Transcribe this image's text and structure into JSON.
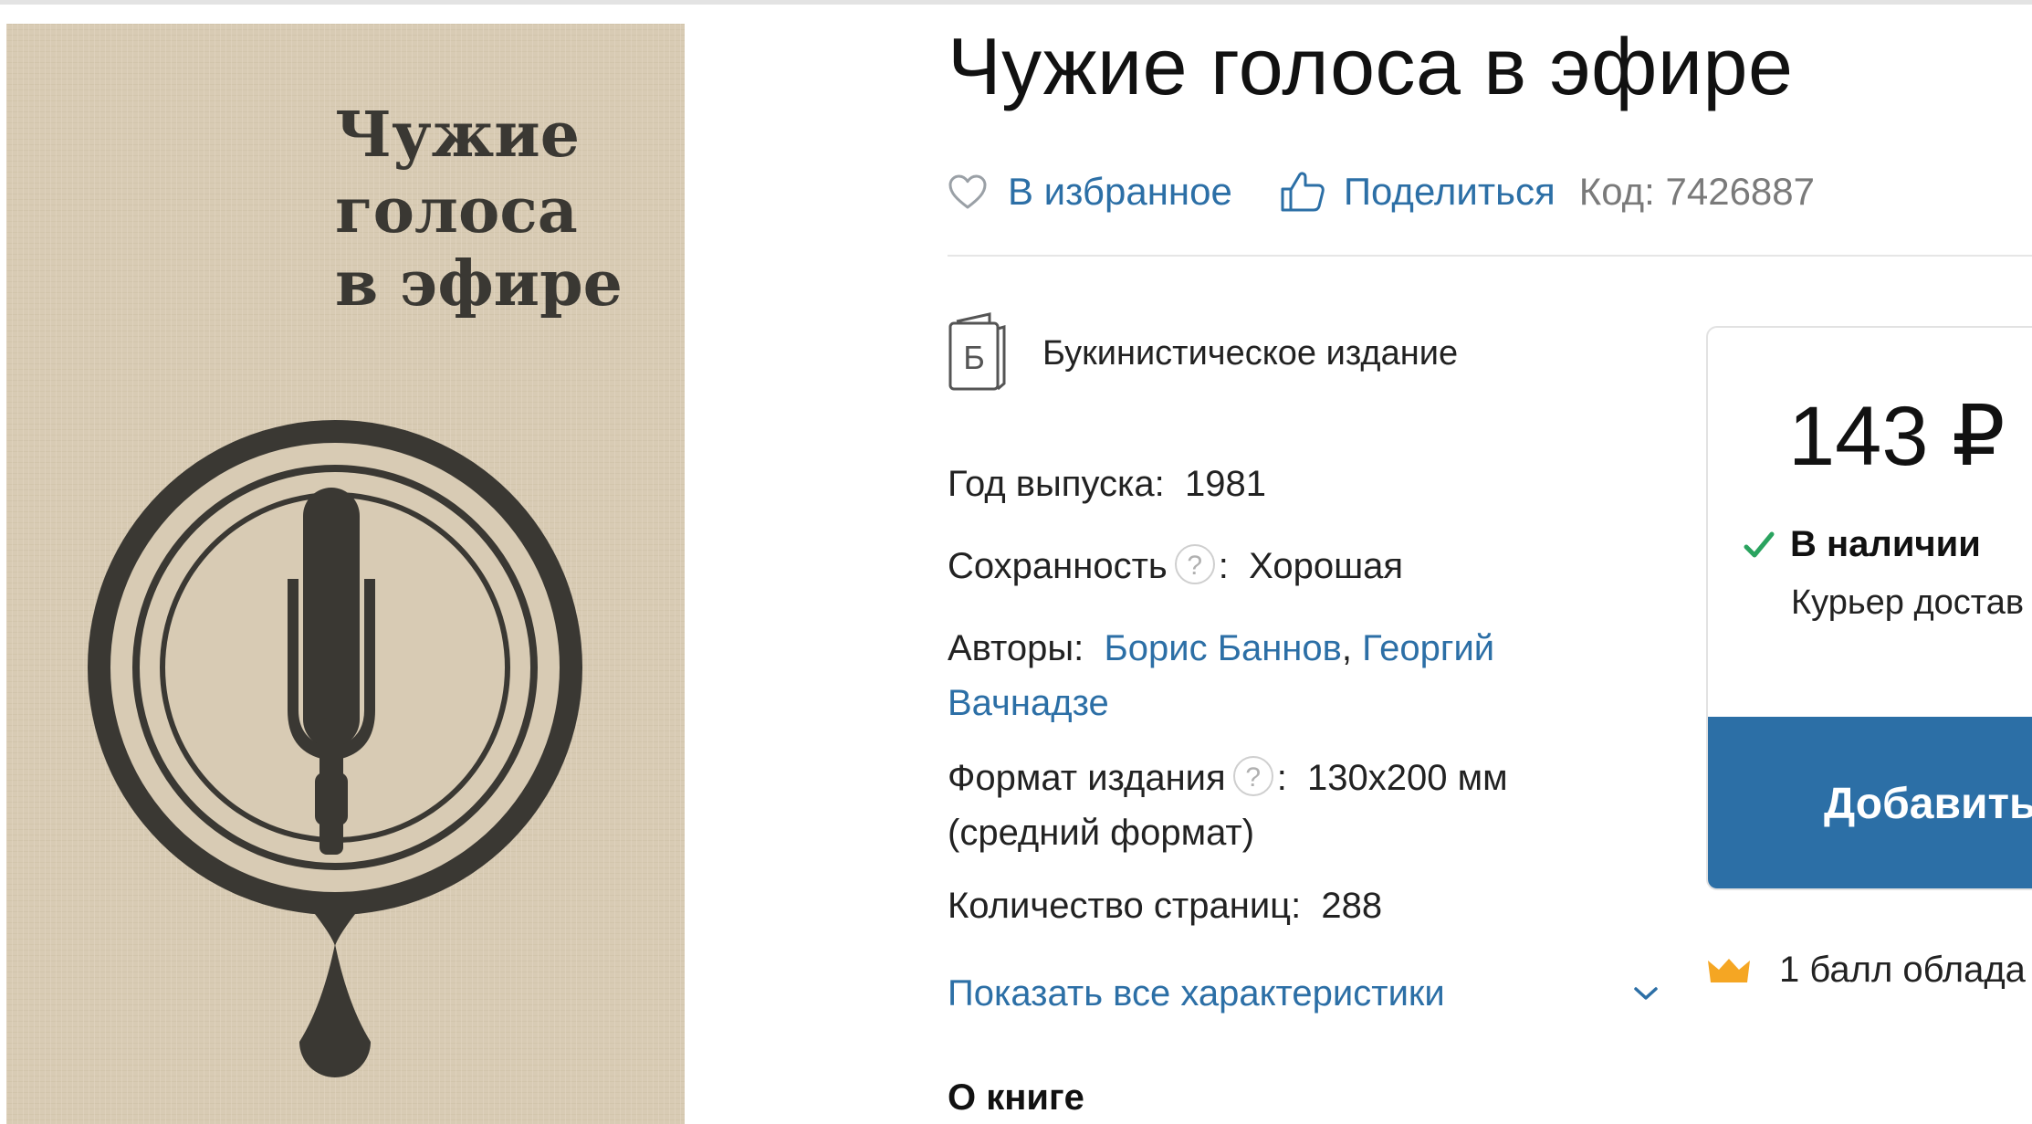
{
  "product": {
    "title": "Чужие голоса в эфире",
    "cover_title_lines": [
      "Чужие",
      "голоса",
      "в эфире"
    ]
  },
  "actions": {
    "favorite_label": "В избранное",
    "share_label": "Поделиться",
    "code_text": "Код: 7426887"
  },
  "edition": {
    "badge_letter": "Б",
    "label": "Букинистическое издание"
  },
  "characteristics": {
    "year_key": "Год выпуска:",
    "year_value": "1981",
    "condition_key": "Сохранность",
    "condition_help": "?",
    "condition_colon": ":",
    "condition_value": "Хорошая",
    "authors_key": "Авторы:",
    "author_1": "Борис Баннов",
    "author_sep": ",",
    "author_2_line1": "Георгий",
    "author_2_line2": "Вачнадзе",
    "format_key": "Формат издания",
    "format_help": "?",
    "format_colon": ":",
    "format_value_line1": "130x200 мм",
    "format_value_line2": "(средний формат)",
    "pages_key": "Количество страниц:",
    "pages_value": "288"
  },
  "show_all_label": "Показать все характеристики",
  "about_heading": "О книге",
  "purchase": {
    "price": "143 ₽",
    "availability": "В наличии",
    "courier_text": "Курьер достав",
    "add_button_label": "Добавить",
    "bonus_text": "1 балл облада"
  },
  "colors": {
    "link": "#2c6fa6",
    "button": "#2c6fa6",
    "check": "#2aa35f",
    "crown": "#f5a623",
    "cover_bg": "#d8cbb4",
    "cover_ink": "#3a3833"
  },
  "icons": {
    "favorite": "heart-icon",
    "share": "thumbs-up-icon",
    "edition": "book-icon",
    "show_all": "chevron-down-icon",
    "availability": "check-icon",
    "bonus": "crown-icon"
  }
}
